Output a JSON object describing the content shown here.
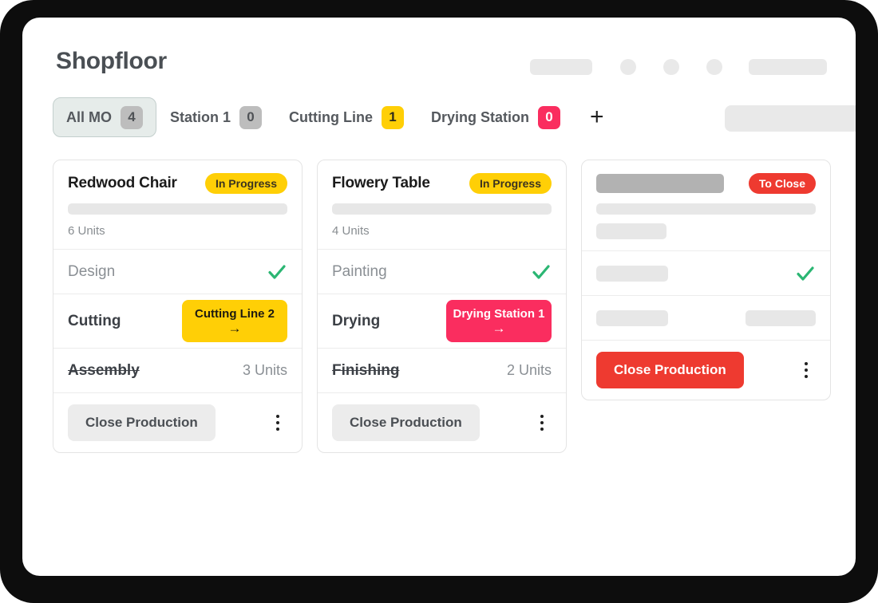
{
  "header": {
    "title": "Shopfloor",
    "skeletons": [
      "header-pill-left",
      "header-dot-1",
      "header-dot-2",
      "header-dot-3",
      "header-pill-right",
      "search-field-skeleton"
    ]
  },
  "tabs": {
    "add_button_label": "+",
    "items": [
      {
        "label": "All MO",
        "count": "4",
        "badge_color": "#bdbdbd",
        "active": true
      },
      {
        "label": "Station 1",
        "count": "0",
        "badge_color": "#bdbdbd",
        "active": false
      },
      {
        "label": "Cutting Line",
        "count": "1",
        "badge_color": "#ffcf06",
        "active": false
      },
      {
        "label": "Drying Station",
        "count": "0",
        "badge_color": "#fa2d5f",
        "active": false
      }
    ]
  },
  "cards": [
    {
      "title": "Redwood Chair",
      "status": "In Progress",
      "status_color": "#ffcf06",
      "units": "6 Units",
      "done_operation": "Design",
      "active_operation": "Cutting",
      "action_label": "Cutting Line 2",
      "action_arrow": "→",
      "action_color": "#ffcf06",
      "pending_operation": "Assembly",
      "pending_units": "3 Units",
      "close_label": "Close Production"
    },
    {
      "title": "Flowery Table",
      "status": "In Progress",
      "status_color": "#ffcf06",
      "units": "4 Units",
      "done_operation": "Painting",
      "active_operation": "Drying",
      "action_label": "Drying Station 1",
      "action_arrow": "→",
      "action_color": "#fa2d5f",
      "pending_operation": "Finishing",
      "pending_units": "2 Units",
      "close_label": "Close Production"
    }
  ],
  "placeholder_card": {
    "status": "To Close",
    "status_color": "#ee3a30",
    "close_label": "Close Production",
    "close_color": "#ee3a30"
  },
  "colors": {
    "yellow": "#ffcf06",
    "pink": "#fa2d5f",
    "red": "#ee3a30",
    "green_check": "#2bb673",
    "grey_badge": "#bdbdbd",
    "skeleton_light": "#e7e7e7",
    "skeleton_dark": "#b2b2b2",
    "frame_dark": "#0d0d0d"
  }
}
